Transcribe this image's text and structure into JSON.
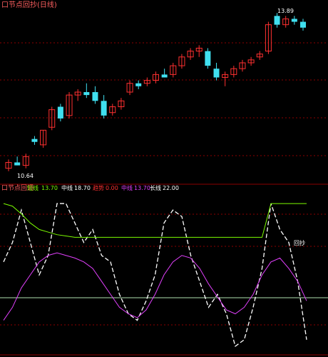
{
  "upper_panel": {
    "title": "口节点回抄(日线)",
    "high_label": "13.89",
    "low_label": "10.64"
  },
  "lower_panel": {
    "title": "口节点回调",
    "legend": [
      {
        "label": "短线",
        "value": "13.70",
        "color": "#7CFC00"
      },
      {
        "label": "中线",
        "value": "18.70",
        "color": "#FFFFFF"
      },
      {
        "label": "趋势",
        "value": "0.00",
        "color": "#FF3030"
      },
      {
        "label": "中线",
        "value": "13.70",
        "color": "#E040FB"
      },
      {
        "label": "长线",
        "value": "22.00",
        "color": "#FFFFFF"
      }
    ],
    "marker_label": "回抄"
  },
  "colors": {
    "up": "#FF3030",
    "down": "#40E0F0",
    "grid": "#8B0000"
  },
  "chart_data": [
    {
      "type": "candlestick",
      "title": "口节点回抄(日线)",
      "up_color": "#FF3030",
      "down_color": "#40E0F0",
      "candles": [
        {
          "o": 10.6,
          "h": 10.9,
          "l": 10.5,
          "c": 10.8
        },
        {
          "o": 10.8,
          "h": 11.0,
          "l": 10.7,
          "c": 10.7
        },
        {
          "o": 10.7,
          "h": 11.1,
          "l": 10.6,
          "c": 11.0
        },
        {
          "o": 11.6,
          "h": 11.7,
          "l": 11.4,
          "c": 11.5
        },
        {
          "o": 11.4,
          "h": 11.9,
          "l": 11.3,
          "c": 11.9
        },
        {
          "o": 12.0,
          "h": 12.7,
          "l": 11.9,
          "c": 12.6
        },
        {
          "o": 12.7,
          "h": 12.8,
          "l": 12.2,
          "c": 12.3
        },
        {
          "o": 12.4,
          "h": 13.2,
          "l": 12.3,
          "c": 13.1
        },
        {
          "o": 13.1,
          "h": 13.3,
          "l": 12.9,
          "c": 13.2
        },
        {
          "o": 13.2,
          "h": 13.5,
          "l": 13.0,
          "c": 13.1
        },
        {
          "o": 13.2,
          "h": 13.4,
          "l": 12.8,
          "c": 12.9
        },
        {
          "o": 12.9,
          "h": 13.1,
          "l": 12.3,
          "c": 12.4
        },
        {
          "o": 12.5,
          "h": 12.8,
          "l": 12.4,
          "c": 12.7
        },
        {
          "o": 12.7,
          "h": 13.0,
          "l": 12.6,
          "c": 12.9
        },
        {
          "o": 13.2,
          "h": 13.6,
          "l": 13.1,
          "c": 13.5
        },
        {
          "o": 13.5,
          "h": 13.6,
          "l": 13.3,
          "c": 13.4
        },
        {
          "o": 13.5,
          "h": 13.7,
          "l": 13.4,
          "c": 13.6
        },
        {
          "o": 13.6,
          "h": 13.9,
          "l": 13.5,
          "c": 13.8
        },
        {
          "o": 13.8,
          "h": 14.0,
          "l": 13.7,
          "c": 13.7
        },
        {
          "o": 13.8,
          "h": 14.2,
          "l": 13.7,
          "c": 14.1
        },
        {
          "o": 14.1,
          "h": 14.5,
          "l": 14.0,
          "c": 14.4
        },
        {
          "o": 14.4,
          "h": 14.7,
          "l": 14.3,
          "c": 14.6
        },
        {
          "o": 14.6,
          "h": 14.8,
          "l": 14.4,
          "c": 14.7
        },
        {
          "o": 14.6,
          "h": 14.7,
          "l": 14.0,
          "c": 14.1
        },
        {
          "o": 14.0,
          "h": 14.2,
          "l": 13.6,
          "c": 13.7
        },
        {
          "o": 13.7,
          "h": 13.9,
          "l": 13.4,
          "c": 13.8
        },
        {
          "o": 13.8,
          "h": 14.1,
          "l": 13.7,
          "c": 14.0
        },
        {
          "o": 14.0,
          "h": 14.3,
          "l": 13.9,
          "c": 14.2
        },
        {
          "o": 14.2,
          "h": 14.4,
          "l": 14.1,
          "c": 14.3
        },
        {
          "o": 14.4,
          "h": 14.6,
          "l": 14.3,
          "c": 14.5
        },
        {
          "o": 14.6,
          "h": 15.6,
          "l": 14.5,
          "c": 15.5
        },
        {
          "o": 15.8,
          "h": 15.9,
          "l": 15.4,
          "c": 15.5
        },
        {
          "o": 15.5,
          "h": 15.8,
          "l": 15.4,
          "c": 15.7
        },
        {
          "o": 15.7,
          "h": 15.8,
          "l": 15.5,
          "c": 15.6
        },
        {
          "o": 15.6,
          "h": 15.7,
          "l": 15.3,
          "c": 15.4
        }
      ]
    },
    {
      "type": "line",
      "title": "口节点回调",
      "x": [
        0,
        1,
        2,
        3,
        4,
        5,
        6,
        7,
        8,
        9,
        10,
        11,
        12,
        13,
        14,
        15,
        16,
        17,
        18,
        19,
        20,
        21,
        22,
        23,
        24,
        25,
        26,
        27,
        28,
        29,
        30,
        31,
        32,
        33,
        34
      ],
      "series": [
        {
          "name": "短线",
          "color": "#FFFFFF",
          "values": [
            55,
            70,
            95,
            70,
            45,
            60,
            100,
            100,
            85,
            70,
            80,
            60,
            55,
            30,
            15,
            10,
            25,
            45,
            85,
            95,
            90,
            60,
            40,
            20,
            30,
            15,
            -10,
            -5,
            20,
            50,
            100,
            80,
            70,
            40,
            -5
          ]
        },
        {
          "name": "中线",
          "color": "#E040FB",
          "values": [
            10,
            20,
            35,
            45,
            55,
            60,
            62,
            60,
            58,
            55,
            50,
            40,
            30,
            20,
            15,
            12,
            18,
            30,
            45,
            55,
            60,
            58,
            50,
            38,
            28,
            18,
            15,
            20,
            30,
            45,
            55,
            58,
            50,
            40,
            25
          ]
        },
        {
          "name": "长线",
          "color": "#7CFC00",
          "values": [
            100,
            98,
            92,
            85,
            80,
            78,
            76,
            75,
            74,
            74,
            74,
            74,
            74,
            74,
            74,
            74,
            74,
            74,
            74,
            74,
            74,
            74,
            74,
            74,
            74,
            74,
            74,
            74,
            74,
            74,
            100,
            100,
            100,
            100,
            100
          ]
        }
      ]
    }
  ]
}
